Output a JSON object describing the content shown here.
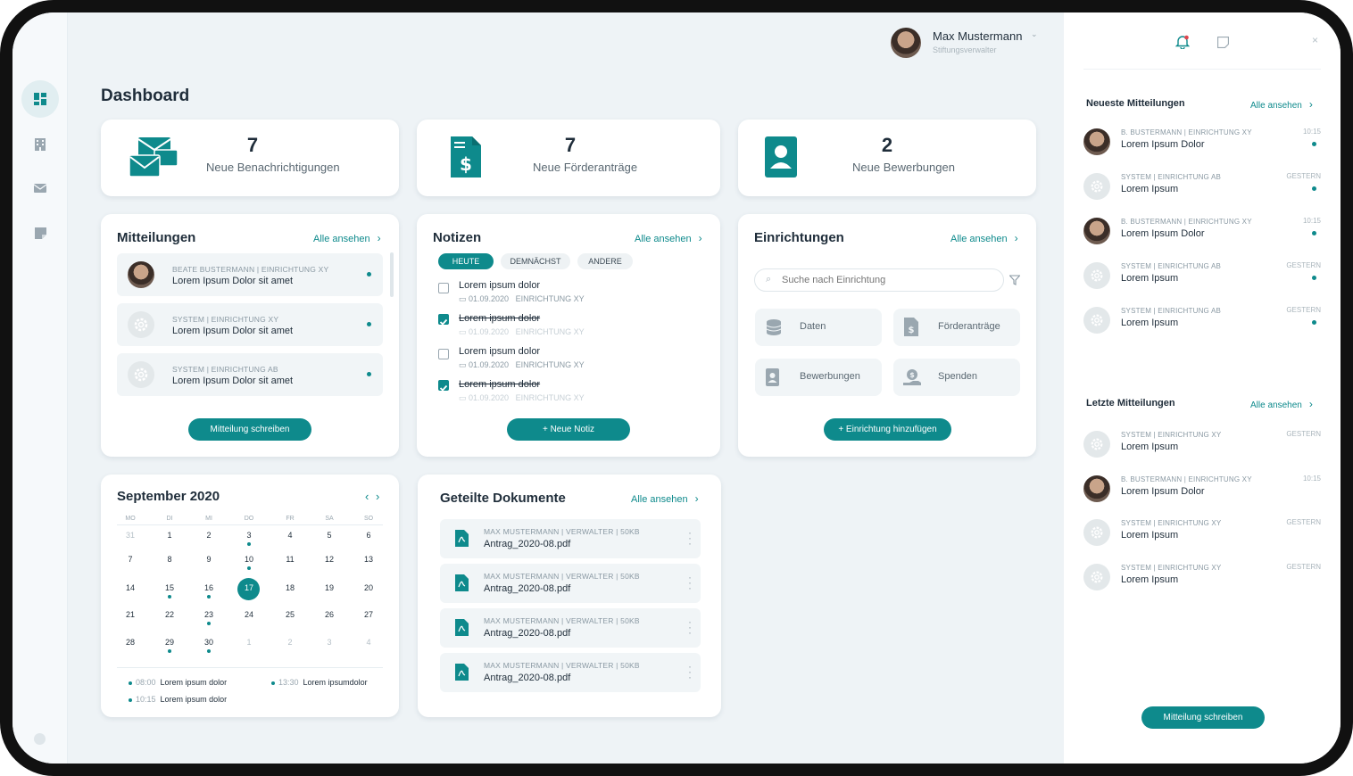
{
  "header": {
    "user_name": "Max Mustermann",
    "user_role": "Stiftungsverwalter"
  },
  "page_title": "Dashboard",
  "stats": [
    {
      "value": "7",
      "label": "Neue Benachrichtigungen",
      "icon": "mail-stack-icon"
    },
    {
      "value": "7",
      "label": "Neue Förderanträge",
      "icon": "dollar-document-icon"
    },
    {
      "value": "2",
      "label": "Neue Bewerbungen",
      "icon": "user-badge-icon"
    }
  ],
  "mitteilungen": {
    "title": "Mitteilungen",
    "link": "Alle ansehen",
    "items": [
      {
        "meta": "BEATE BUSTERMANN | EINRICHTUNG XY",
        "subject": "Lorem Ipsum Dolor sit amet",
        "avatar": "photo"
      },
      {
        "meta": "SYSTEM | EINRICHTUNG XY",
        "subject": "Lorem Ipsum Dolor sit amet",
        "avatar": "system"
      },
      {
        "meta": "SYSTEM | EINRICHTUNG AB",
        "subject": "Lorem Ipsum Dolor sit amet",
        "avatar": "system"
      }
    ],
    "button": "Mitteilung schreiben"
  },
  "notizen": {
    "title": "Notizen",
    "link": "Alle ansehen",
    "tabs": [
      "HEUTE",
      "DEMNÄCHST",
      "ANDERE"
    ],
    "items": [
      {
        "title": "Lorem ipsum dolor",
        "date": "01.09.2020",
        "place": "EINRICHTUNG XY",
        "done": false
      },
      {
        "title": "Lorem ipsum dolor",
        "date": "01.09.2020",
        "place": "EINRICHTUNG XY",
        "done": true
      },
      {
        "title": "Lorem ipsum dolor",
        "date": "01.09.2020",
        "place": "EINRICHTUNG XY",
        "done": false
      },
      {
        "title": "Lorem ipsum dolor",
        "date": "01.09.2020",
        "place": "EINRICHTUNG XY",
        "done": true
      }
    ],
    "button": "+ Neue Notiz"
  },
  "einrichtungen": {
    "title": "Einrichtungen",
    "link": "Alle ansehen",
    "search_placeholder": "Suche nach Einrichtung",
    "tiles": [
      {
        "label": "Daten",
        "icon": "database-icon"
      },
      {
        "label": "Förderanträge",
        "icon": "dollar-document-icon"
      },
      {
        "label": "Bewerbungen",
        "icon": "user-badge-icon"
      },
      {
        "label": "Spenden",
        "icon": "donation-icon"
      }
    ],
    "button": "+ Einrichtung hinzufügen"
  },
  "calendar": {
    "title": "September 2020",
    "weekdays": [
      "MO",
      "DI",
      "MI",
      "DO",
      "FR",
      "SA",
      "SO"
    ],
    "weeks": [
      [
        "31",
        "1",
        "2",
        "3",
        "4",
        "5",
        "6"
      ],
      [
        "7",
        "8",
        "9",
        "10",
        "11",
        "12",
        "13"
      ],
      [
        "14",
        "15",
        "16",
        "17",
        "18",
        "19",
        "20"
      ],
      [
        "21",
        "22",
        "23",
        "24",
        "25",
        "26",
        "27"
      ],
      [
        "28",
        "29",
        "30",
        "1",
        "2",
        "3",
        "4"
      ]
    ],
    "selected": "17",
    "events": [
      {
        "time": "08:00",
        "text": "Lorem ipsum dolor"
      },
      {
        "time": "13:30",
        "text": "Lorem ipsumdolor"
      },
      {
        "time": "10:15",
        "text": "Lorem ipsum dolor"
      }
    ]
  },
  "dokumente": {
    "title": "Geteilte Dokumente",
    "link": "Alle ansehen",
    "items": [
      {
        "meta": "MAX MUSTERMANN | VERWALTER | 50KB",
        "name": "Antrag_2020-08.pdf"
      },
      {
        "meta": "MAX MUSTERMANN | VERWALTER | 50KB",
        "name": "Antrag_2020-08.pdf"
      },
      {
        "meta": "MAX MUSTERMANN | VERWALTER | 50KB",
        "name": "Antrag_2020-08.pdf"
      },
      {
        "meta": "MAX MUSTERMANN | VERWALTER | 50KB",
        "name": "Antrag_2020-08.pdf"
      }
    ]
  },
  "right_panel": {
    "neueste": {
      "title": "Neueste Mitteilungen",
      "link": "Alle ansehen",
      "items": [
        {
          "meta": "B. BUSTERMANN | EINRICHTUNG XY",
          "subject": "Lorem Ipsum Dolor",
          "time": "10:15",
          "avatar": "photo"
        },
        {
          "meta": "SYSTEM | EINRICHTUNG AB",
          "subject": "Lorem Ipsum",
          "time": "GESTERN",
          "avatar": "system"
        },
        {
          "meta": "B. BUSTERMANN | EINRICHTUNG XY",
          "subject": "Lorem Ipsum Dolor",
          "time": "10:15",
          "avatar": "photo"
        },
        {
          "meta": "SYSTEM | EINRICHTUNG AB",
          "subject": "Lorem Ipsum",
          "time": "GESTERN",
          "avatar": "system"
        },
        {
          "meta": "SYSTEM | EINRICHTUNG AB",
          "subject": "Lorem Ipsum",
          "time": "GESTERN",
          "avatar": "system"
        }
      ]
    },
    "letzte": {
      "title": "Letzte Mitteilungen",
      "link": "Alle ansehen",
      "items": [
        {
          "meta": "SYSTEM | EINRICHTUNG XY",
          "subject": "Lorem Ipsum",
          "time": "GESTERN",
          "avatar": "system"
        },
        {
          "meta": "B. BUSTERMANN | EINRICHTUNG XY",
          "subject": "Lorem Ipsum Dolor",
          "time": "10:15",
          "avatar": "photo"
        },
        {
          "meta": "SYSTEM | EINRICHTUNG XY",
          "subject": "Lorem Ipsum",
          "time": "GESTERN",
          "avatar": "system"
        },
        {
          "meta": "SYSTEM | EINRICHTUNG XY",
          "subject": "Lorem Ipsum",
          "time": "GESTERN",
          "avatar": "system"
        }
      ]
    },
    "button": "Mitteilung schreiben"
  },
  "colors": {
    "accent": "#0e8a8c",
    "background": "#eef3f6",
    "alert": "#e0464f"
  }
}
